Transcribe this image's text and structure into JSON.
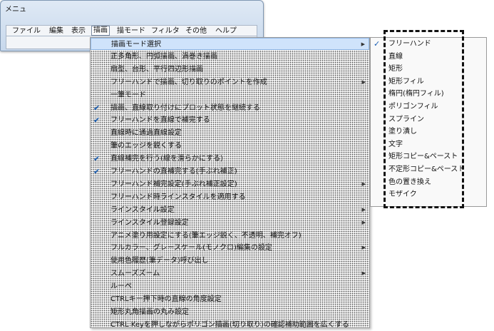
{
  "window": {
    "title": "メニュ",
    "menubar": [
      "ファイル",
      "編集",
      "表示",
      "描画",
      "描モード",
      "フィルタ",
      "その他",
      "ヘルプ"
    ],
    "active_menu": "描画"
  },
  "dropdown": {
    "items": [
      {
        "label": "描画モード選択",
        "checked": false,
        "submenu": true,
        "highlight": true
      },
      {
        "label": "正多角形、円弧描画、渦巻き描画",
        "checked": false,
        "submenu": false
      },
      {
        "label": "扇型、台形、平行四辺形描画",
        "checked": false,
        "submenu": false
      },
      {
        "label": "フリーハンドで描画、切り取りのポイントを作成",
        "checked": false,
        "submenu": true
      },
      {
        "label": "一筆モード",
        "checked": false,
        "submenu": false
      },
      {
        "label": "描画、直線取り付けにプロット状態を継続する",
        "checked": true,
        "submenu": false
      },
      {
        "label": "フリーハンドを直線で補完する",
        "checked": true,
        "submenu": false
      },
      {
        "label": "直線時に通過直線設定",
        "checked": false,
        "submenu": false
      },
      {
        "label": "筆のエッジを鋭くする",
        "checked": false,
        "submenu": false
      },
      {
        "label": "直線補完を行う(線を滑らかにする)",
        "checked": true,
        "submenu": false
      },
      {
        "label": "フリーハンドの直補完する(手ぶれ補正)",
        "checked": true,
        "submenu": false
      },
      {
        "label": "フリーハンド補完設定(手ぶれ補正設定)",
        "checked": false,
        "submenu": true
      },
      {
        "label": "フリーハンド時ラインスタイルを適用する",
        "checked": false,
        "submenu": false
      },
      {
        "label": "ラインスタイル設定",
        "checked": false,
        "submenu": true
      },
      {
        "label": "ラインスタイル登録設定",
        "checked": false,
        "submenu": true
      },
      {
        "label": "アニメ塗り用設定にする(筆エッジ鋭く、不透明、補完オフ)",
        "checked": false,
        "submenu": false
      },
      {
        "label": "フルカラー、グレースケール(モノクロ)編集の設定",
        "checked": false,
        "submenu": true
      },
      {
        "label": "使用色履歴(筆データ)呼び出し",
        "checked": false,
        "submenu": false
      },
      {
        "label": "スムーズズーム",
        "checked": false,
        "submenu": true
      },
      {
        "label": "ルーペ",
        "checked": false,
        "submenu": false
      },
      {
        "label": "CTRLキー押下時の直線の角度設定",
        "checked": false,
        "submenu": false
      },
      {
        "label": "矩形丸角描画の丸み設定",
        "checked": false,
        "submenu": false
      },
      {
        "label": "CTRL Keyを押しながらポリゴン描画(切り取り)の確認補助範囲を広くする",
        "checked": false,
        "submenu": false
      }
    ]
  },
  "submenu": {
    "items": [
      {
        "label": "フリーハンド",
        "checked": true
      },
      {
        "label": "直線",
        "checked": false
      },
      {
        "label": "矩形",
        "checked": false
      },
      {
        "label": "矩形フィル",
        "checked": false
      },
      {
        "label": "楕円(楕円フィル)",
        "checked": false
      },
      {
        "label": "ポリゴンフィル",
        "checked": false
      },
      {
        "label": "スプライン",
        "checked": false
      },
      {
        "label": "塗り潰し",
        "checked": false
      },
      {
        "label": "文字",
        "checked": false
      },
      {
        "label": "矩形コピー&ペースト",
        "checked": false
      },
      {
        "label": "不定形コピー&ペースト",
        "checked": false
      },
      {
        "label": "色の置き換え",
        "checked": false
      },
      {
        "label": "モザイク",
        "checked": false
      }
    ]
  },
  "colors": {
    "check": "#1a5fb4",
    "highlight": "#cfe3fb",
    "menu_bg": "#f2f2f2",
    "window_frame": "#c7d8ec"
  }
}
